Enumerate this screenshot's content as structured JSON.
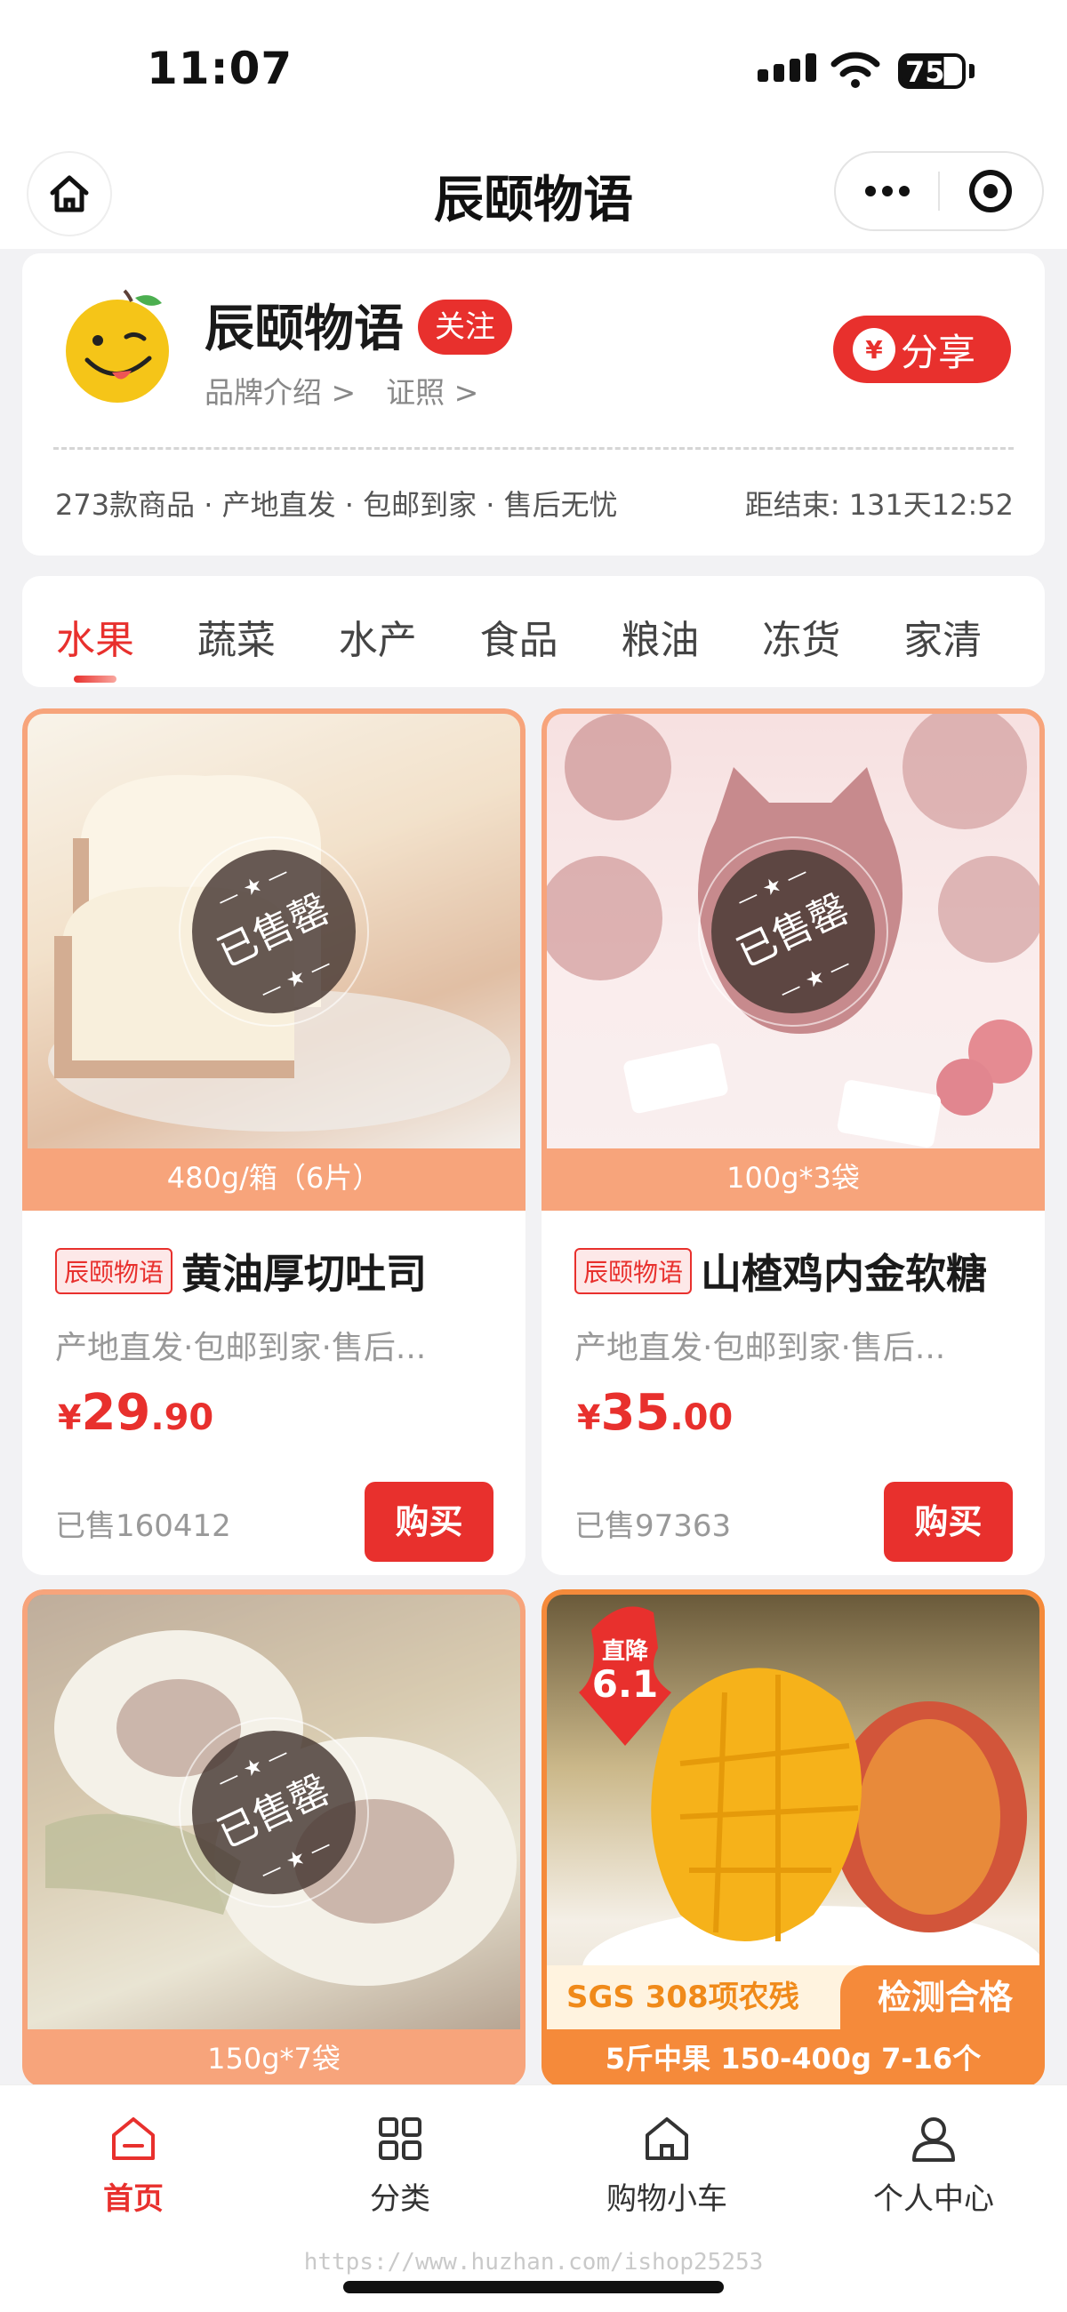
{
  "status_bar": {
    "time": "11:07",
    "battery": "75"
  },
  "nav": {
    "title": "辰颐物语"
  },
  "shop": {
    "name": "辰颐物语",
    "follow": "关注",
    "brand_intro": "品牌介绍 >",
    "license": "证照 >",
    "share": "分享",
    "meta": "273款商品 · 产地直发 · 包邮到家 · 售后无忧",
    "countdown": "距结束: 131天12:52"
  },
  "tabs": [
    "水果",
    "蔬菜",
    "水产",
    "食品",
    "粮油",
    "冻货",
    "家清"
  ],
  "products": [
    {
      "spec": "480g/箱（6片）",
      "brand": "辰颐物语",
      "name": "黄油厚切吐司",
      "desc": "产地直发·包邮到家·售后...",
      "currency": "¥",
      "price_int": "29",
      "price_dec": ".90",
      "sold": "已售160412",
      "buy": "购买",
      "status": "已售罄"
    },
    {
      "spec": "100g*3袋",
      "brand": "辰颐物语",
      "name": "山楂鸡内金软糖",
      "desc": "产地直发·包邮到家·售后...",
      "currency": "¥",
      "price_int": "35",
      "price_dec": ".00",
      "sold": "已售97363",
      "buy": "购买",
      "status": "已售罄"
    },
    {
      "spec": "150g*7袋",
      "status": "已售罄"
    },
    {
      "spec": "5斤中果 150-400g 7-16个",
      "badge_top": "直降",
      "badge_num": "6.1",
      "banner_left": "SGS  308项农残",
      "banner_right": "检测合格"
    }
  ],
  "tabbar": [
    {
      "label": "首页",
      "icon": "home-icon",
      "active": true
    },
    {
      "label": "分类",
      "icon": "category-grid-icon"
    },
    {
      "label": "购物小车",
      "icon": "cart-house-icon"
    },
    {
      "label": "个人中心",
      "icon": "user-icon"
    }
  ],
  "watermark": "https://www.huzhan.com/ishop25253",
  "colors": {
    "accent": "#e8302d",
    "image_border": "#f7a47b"
  }
}
